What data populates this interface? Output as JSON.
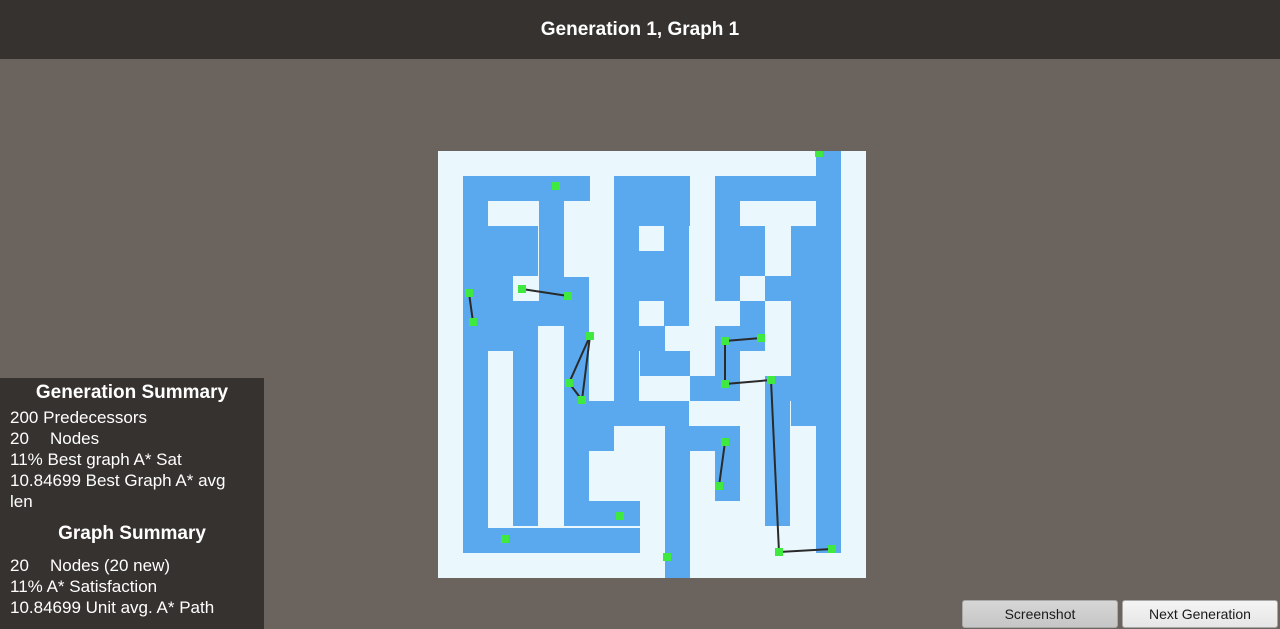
{
  "header": {
    "title": "Generation 1, Graph 1"
  },
  "colors": {
    "background": "#6b635d",
    "bar": "#363230",
    "maze_path": "#eaf8fd",
    "maze_wall": "#5aa9ee",
    "node": "#3fe93f",
    "edge": "#2a2a2a"
  },
  "generation_summary": {
    "title": "Generation Summary",
    "rows": [
      {
        "value": "200",
        "label": "Predecessors"
      },
      {
        "value": "20",
        "label": "Nodes"
      },
      {
        "value": "11%",
        "label": "Best graph A* Sat"
      },
      {
        "value": "10.84699",
        "label": "Best Graph A* avg len"
      }
    ]
  },
  "graph_summary": {
    "title": "Graph Summary",
    "rows": [
      {
        "value": "20",
        "label": "Nodes",
        "extra": "(20 new)"
      },
      {
        "value": "11%",
        "label": "A* Satisfaction"
      },
      {
        "value": "10.84699",
        "label": "Unit avg. A* Path"
      }
    ]
  },
  "buttons": {
    "screenshot": "Screenshot",
    "next_generation": "Next Generation"
  }
}
